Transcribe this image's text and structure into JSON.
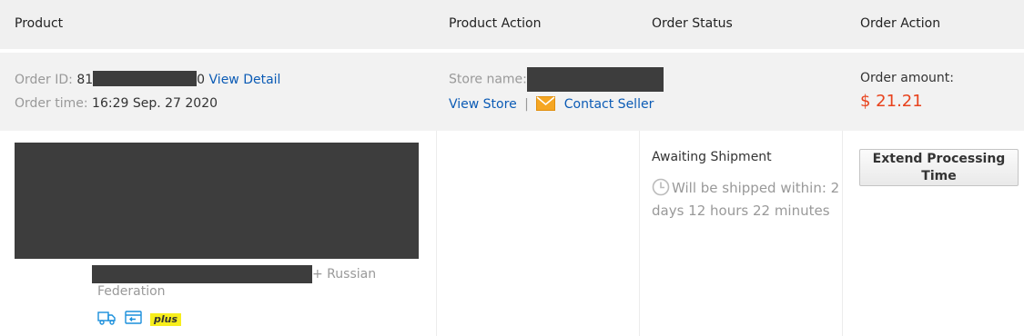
{
  "header": {
    "product": "Product",
    "product_action": "Product Action",
    "order_status": "Order Status",
    "order_action": "Order Action"
  },
  "order": {
    "id_label": "Order ID:",
    "id_prefix": "81",
    "id_suffix": "0",
    "view_detail": "View Detail",
    "time_label": "Order time:",
    "time_value": "16:29 Sep. 27 2020",
    "store_label": "Store name:",
    "view_store": "View Store",
    "separator": "|",
    "contact_seller": "Contact Seller",
    "amount_label": "Order amount:",
    "amount_value": "$ 21.21"
  },
  "item": {
    "ship_suffix": "+ Russian",
    "ship_line2": "Federation",
    "plus_badge": "plus"
  },
  "status": {
    "title": "Awaiting Shipment",
    "ship_line1": "Will be shipped within: 2",
    "ship_line2": "days 12 hours 22 minutes"
  },
  "actions": {
    "extend_line1": "Extend Processing",
    "extend_line2": "Time"
  },
  "colors": {
    "link": "#0b5bb5",
    "amount": "#e8431d",
    "header_bg": "#f0f0f0",
    "plus_badge": "#f7ee1c"
  }
}
